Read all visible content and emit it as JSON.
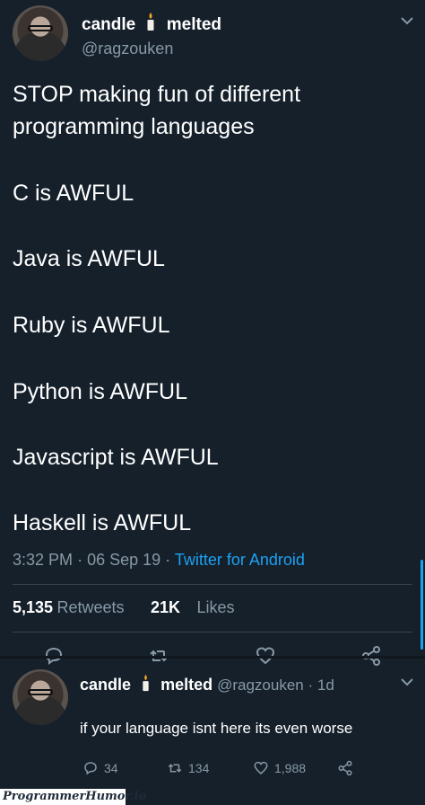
{
  "tweet": {
    "author_name_part1": "candle",
    "author_name_part2": "melted",
    "handle": "@ragzouken",
    "lines": [
      "STOP making fun of different",
      "programming languages",
      "C is AWFUL",
      "Java is AWFUL",
      "Ruby is AWFUL",
      "Python is AWFUL",
      "Javascript is AWFUL",
      "Haskell is AWFUL"
    ],
    "time": "3:32 PM",
    "sep1": "·",
    "date": "06 Sep 19",
    "sep2": "·",
    "source": "Twitter for Android",
    "retweets_count": "5,135",
    "retweets_label": "Retweets",
    "likes_count": "21K",
    "likes_label": "Likes"
  },
  "reply": {
    "author_name_part1": "candle",
    "author_name_part2": "melted",
    "handle_and_time": "@ragzouken · 1d",
    "text": "if your language isnt here its even worse",
    "reply_count": "34",
    "retweet_count": "134",
    "like_count": "1,988"
  },
  "watermark": "ProgrammerHumor.io",
  "colors": {
    "background": "#15202b",
    "secondary_text": "#8899a6",
    "link": "#1da1f2",
    "divider": "#38444d"
  },
  "icons": [
    "chevron-down-icon",
    "candle-icon",
    "reply-icon",
    "retweet-icon",
    "like-icon",
    "share-icon"
  ]
}
